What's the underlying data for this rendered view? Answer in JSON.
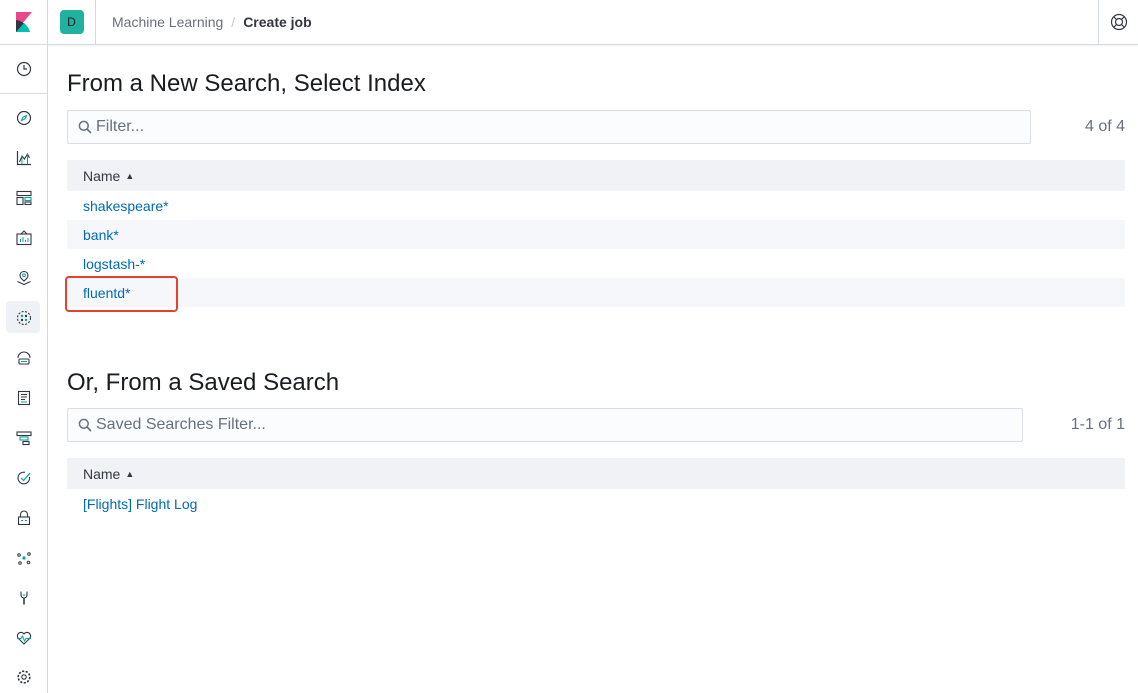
{
  "header": {
    "space_initial": "D",
    "breadcrumbs": [
      "Machine Learning",
      "Create job"
    ],
    "breadcrumb_separator": "/"
  },
  "sidebar": {
    "items": [
      {
        "icon": "clock-icon"
      },
      {
        "icon": "compass-icon"
      },
      {
        "icon": "chart-icon"
      },
      {
        "icon": "dashboard-icon"
      },
      {
        "icon": "canvas-icon"
      },
      {
        "icon": "maps-icon"
      },
      {
        "icon": "machine-learning-icon",
        "active": true
      },
      {
        "icon": "infrastructure-icon"
      },
      {
        "icon": "logs-icon"
      },
      {
        "icon": "apm-icon"
      },
      {
        "icon": "uptime-icon"
      },
      {
        "icon": "siem-icon"
      },
      {
        "icon": "graph-icon"
      },
      {
        "icon": "dev-tools-icon"
      },
      {
        "icon": "monitoring-icon"
      },
      {
        "icon": "management-icon"
      }
    ]
  },
  "index_section": {
    "title": "From a New Search, Select Index",
    "filter_placeholder": "Filter...",
    "count": "4 of 4",
    "column": "Name",
    "rows": [
      "shakespeare*",
      "bank*",
      "logstash-*",
      "fluentd*"
    ]
  },
  "saved_section": {
    "title": "Or, From a Saved Search",
    "filter_placeholder": "Saved Searches Filter...",
    "count": "1-1 of 1",
    "column": "Name",
    "rows": [
      "[Flights] Flight Log"
    ]
  },
  "colors": {
    "link": "#006bb4",
    "highlight": "#e7412e",
    "accent": "#20b29f"
  }
}
